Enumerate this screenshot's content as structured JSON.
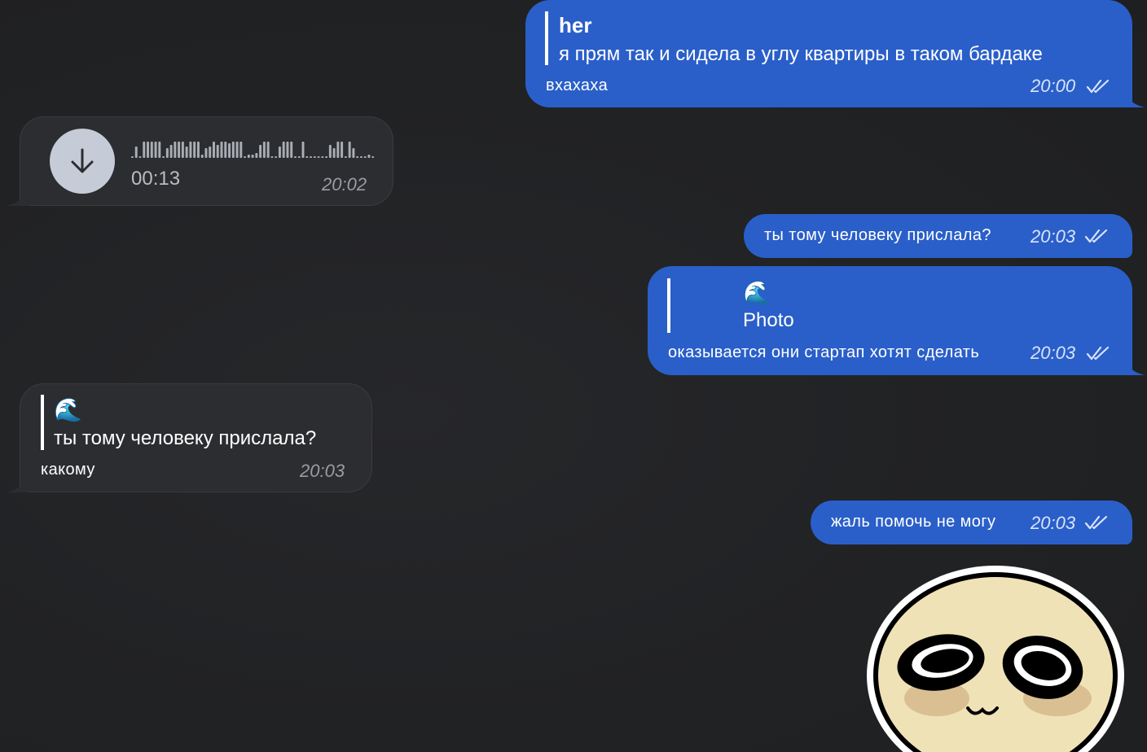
{
  "messages": [
    {
      "direction": "out",
      "reply_to_name": "her",
      "reply_to_text": "я прям так и сидела в углу квартиры в таком бардаке",
      "text": "вхахаха",
      "time": "20:00",
      "read": true
    },
    {
      "direction": "in",
      "type": "voice",
      "duration": "00:13",
      "time": "20:02",
      "button_icon": "download-arrow-icon"
    },
    {
      "direction": "out",
      "text": "ты тому человеку прислала?",
      "time": "20:03",
      "read": true
    },
    {
      "direction": "out",
      "reply_to_name": "🌊",
      "reply_to_text": "Photo",
      "text": "оказывается они стартап хотят сделать",
      "time": "20:03",
      "read": true
    },
    {
      "direction": "in",
      "reply_to_name": "🌊",
      "reply_to_text": "ты тому человеку прислала?",
      "text": "какому",
      "time": "20:03"
    },
    {
      "direction": "out",
      "text": "жаль помочь не могу",
      "time": "20:03",
      "read": true
    },
    {
      "direction": "in",
      "type": "sticker",
      "sticker": "round-face-sticker"
    }
  ],
  "colors": {
    "background": "#212224",
    "outgoing_bubble": "#2a5fc9",
    "incoming_bubble": "#2c2d30",
    "voice_button": "#c5ccd8",
    "sticker_face": "#efe2b6"
  }
}
